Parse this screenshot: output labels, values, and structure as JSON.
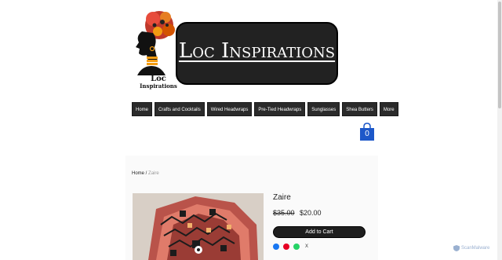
{
  "brand": {
    "logo_line1": "Loc",
    "logo_line2": "Inspirations",
    "banner_title": "Loc Inspirations"
  },
  "nav": {
    "items": [
      "Home",
      "Crafts and Cocktails",
      "Wired Headwraps",
      "Pre-Tied Headwraps",
      "Sunglasses",
      "Shea Butters",
      "More"
    ]
  },
  "cart": {
    "count": "0"
  },
  "breadcrumb": {
    "home": "Home",
    "separator": " / ",
    "current": "Zaire"
  },
  "product": {
    "title": "Zaire",
    "old_price": "$35.00",
    "new_price": "$20.00",
    "add_to_cart": "Add to Cart"
  },
  "share": {
    "icons": [
      "facebook-icon",
      "pinterest-icon",
      "whatsapp-icon",
      "x-icon"
    ],
    "colors": {
      "facebook": "#1877f2",
      "pinterest": "#e60023",
      "whatsapp": "#25d366"
    },
    "x_glyph": "X"
  },
  "badge": {
    "scanmalware": "ScanMalware"
  }
}
